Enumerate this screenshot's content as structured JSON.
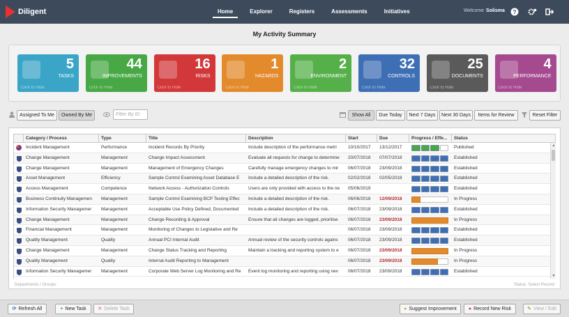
{
  "app": {
    "logo_text": "Diligent"
  },
  "nav": [
    "Home",
    "Explorer",
    "Registers",
    "Assessments",
    "Initiatives"
  ],
  "user": {
    "welcome": "Welcome",
    "name": "Solisma"
  },
  "page_title": "My Activity Summary",
  "tiles": [
    {
      "num": "5",
      "label": "TASKS",
      "hide": "Click to Hide",
      "color": "#3aa5c7",
      "icon": "pencil-icon"
    },
    {
      "num": "44",
      "label": "IMPROVEMENTS",
      "hide": "Click to Hide",
      "color": "#48a845",
      "icon": "arrow-up-icon"
    },
    {
      "num": "16",
      "label": "RISKS",
      "hide": "Click to Hide",
      "color": "#d2383a",
      "icon": "warning-icon"
    },
    {
      "num": "1",
      "label": "HAZARDS",
      "hide": "Click to Hide",
      "color": "#e38a2d",
      "icon": "heartbeat-icon"
    },
    {
      "num": "2",
      "label": "ENVIRONMENT",
      "hide": "Click to Hide",
      "color": "#56b04a",
      "icon": "leaf-icon"
    },
    {
      "num": "32",
      "label": "CONTROLS",
      "hide": "Click to Hide",
      "color": "#3e6fb5",
      "icon": "shield-icon"
    },
    {
      "num": "25",
      "label": "DOCUMENTS",
      "hide": "Click to Hide",
      "color": "#5a5a5a",
      "icon": "document-icon"
    },
    {
      "num": "4",
      "label": "PERFORMANCE",
      "hide": "Click to Hide",
      "color": "#a54a8e",
      "icon": "gauge-icon"
    }
  ],
  "filters": {
    "assigned": "Assigned To Me",
    "owned": "Owned By Me",
    "filter_placeholder": "Filter By ID",
    "show_all": "Show All",
    "due_today": "Due Today",
    "next7": "Next 7 Days",
    "next30": "Next 30 Days",
    "review": "Items for Review",
    "reset": "Reset Filter"
  },
  "table": {
    "headers": [
      "Category / Process",
      "Type",
      "Title",
      "Description",
      "Start",
      "Due",
      "Progress / Effe...",
      "Status"
    ],
    "rows": [
      {
        "cat": "Incident Management",
        "type": "Performance",
        "title": "Incident Records By Priority",
        "desc": "Include description of the performance metri",
        "start": "10/10/2017",
        "due": "13/12/2017",
        "due_red": false,
        "prog": {
          "kind": "segments",
          "filled": 3,
          "total": 4,
          "color": "#48a845"
        },
        "status": "Published",
        "icon": "pie"
      },
      {
        "cat": "Change Management",
        "type": "Management",
        "title": "Change Impact Assessment",
        "desc": "Evaluate all requests for change to determine",
        "start": "20/07/2018",
        "due": "07/07/2018",
        "due_red": false,
        "prog": {
          "kind": "segments",
          "filled": 4,
          "total": 4,
          "color": "#3e6fb5"
        },
        "status": "Established",
        "icon": "shield"
      },
      {
        "cat": "Change Management",
        "type": "Management",
        "title": "Management of Emergency Changes",
        "desc": "Carefully manage emergency changes to mir",
        "start": "06/07/2018",
        "due": "23/09/2018",
        "due_red": false,
        "prog": {
          "kind": "segments",
          "filled": 4,
          "total": 4,
          "color": "#3e6fb5"
        },
        "status": "Established",
        "icon": "shield"
      },
      {
        "cat": "Asset Management",
        "type": "Efficiency",
        "title": "Sample Control Examining Asset Database E",
        "desc": "Include a detailed description of the risk.",
        "start": "02/02/2018",
        "due": "02/05/2018",
        "due_red": false,
        "prog": {
          "kind": "segments",
          "filled": 4,
          "total": 4,
          "color": "#3e6fb5"
        },
        "status": "Established",
        "icon": "shield"
      },
      {
        "cat": "Access Management",
        "type": "Competence",
        "title": "Network Access - Authorization Controls",
        "desc": "Users are only provided with access to the ne",
        "start": "05/06/2019",
        "due": "",
        "due_red": false,
        "prog": {
          "kind": "segments",
          "filled": 4,
          "total": 4,
          "color": "#3e6fb5"
        },
        "status": "Established",
        "icon": "shield"
      },
      {
        "cat": "Business Continuity Managemen",
        "type": "Management",
        "title": "Sample Control Examining BCP Testing Effec",
        "desc": "Include a detailed description of the risk.",
        "start": "06/06/2018",
        "due": "12/09/2018",
        "due_red": true,
        "prog": {
          "kind": "bar",
          "value": 0.25,
          "color": "#e38a2d"
        },
        "status": "In Progress",
        "icon": "shield"
      },
      {
        "cat": "Information Security Managemer",
        "type": "Management",
        "title": "Acceptable Use Policy Defined, Documented",
        "desc": "Include a detailed description of the risk.",
        "start": "06/07/2018",
        "due": "23/09/2018",
        "due_red": false,
        "prog": {
          "kind": "segments",
          "filled": 4,
          "total": 4,
          "color": "#3e6fb5"
        },
        "status": "Established",
        "icon": "shield"
      },
      {
        "cat": "Change Management",
        "type": "Management",
        "title": "Change Recording & Approval",
        "desc": "Ensure that all changes are logged, prioritise",
        "start": "06/07/2018",
        "due": "23/09/2018",
        "due_red": true,
        "prog": {
          "kind": "bar",
          "value": 1.0,
          "color": "#e38a2d"
        },
        "status": "In Progress",
        "icon": "shield"
      },
      {
        "cat": "Financial Management",
        "type": "Management",
        "title": "Monitoring of Changes to Legislative and Re",
        "desc": "",
        "start": "06/07/2018",
        "due": "23/09/2018",
        "due_red": false,
        "prog": {
          "kind": "segments",
          "filled": 4,
          "total": 4,
          "color": "#3e6fb5"
        },
        "status": "Established",
        "icon": "shield"
      },
      {
        "cat": "Quality Management",
        "type": "Quality",
        "title": "Annual PCI Internal Audit",
        "desc": "Annual review of the security controls agains",
        "start": "06/07/2018",
        "due": "23/09/2018",
        "due_red": false,
        "prog": {
          "kind": "segments",
          "filled": 4,
          "total": 4,
          "color": "#3e6fb5"
        },
        "status": "Established",
        "icon": "shield"
      },
      {
        "cat": "Change Management",
        "type": "Management",
        "title": "Change Status Tracking and Reporting",
        "desc": "Maintain a tracking and reporting system to e",
        "start": "06/07/2018",
        "due": "23/09/2018",
        "due_red": true,
        "prog": {
          "kind": "bar",
          "value": 1.0,
          "color": "#e38a2d"
        },
        "status": "In Progress",
        "icon": "shield"
      },
      {
        "cat": "Quality Management",
        "type": "Quality",
        "title": "Internal Audit Reporting to Management",
        "desc": "",
        "start": "06/07/2018",
        "due": "23/09/2018",
        "due_red": true,
        "prog": {
          "kind": "bar",
          "value": 0.72,
          "color": "#e38a2d"
        },
        "status": "In Progress",
        "icon": "shield"
      },
      {
        "cat": "Information Security Managemer",
        "type": "Management",
        "title": "Corporate Web Server Log Monitoring and Re",
        "desc": "Event log monitoring and reporting using nev",
        "start": "06/07/2018",
        "due": "23/09/2018",
        "due_red": false,
        "prog": {
          "kind": "segments",
          "filled": 4,
          "total": 4,
          "color": "#3e6fb5"
        },
        "status": "Established",
        "icon": "shield"
      }
    ]
  },
  "footer": {
    "left": "Departments / Groups:",
    "right": "Status:  Select Record"
  },
  "bottom": {
    "refresh": "Refresh All",
    "new_task": "New Task",
    "delete_task": "Delete Task",
    "suggest": "Suggest Improvement",
    "record_risk": "Record New Risk",
    "view_edit": "View / Edit"
  }
}
